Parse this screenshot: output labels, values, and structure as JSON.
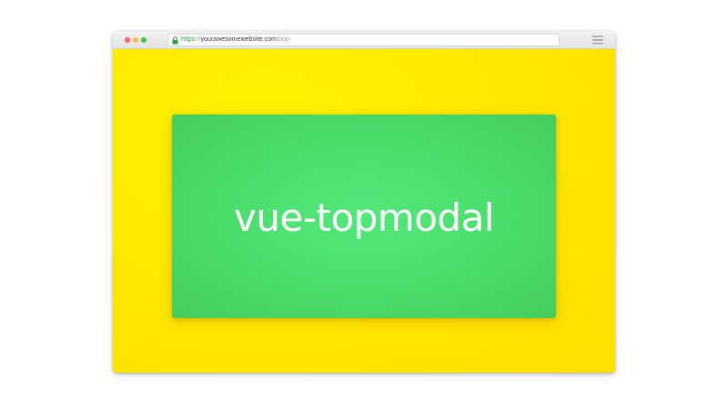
{
  "browser": {
    "url": {
      "scheme": "https",
      "separator": "://",
      "host": "yourawesomewebsite.com",
      "path": "/pop"
    },
    "icons": {
      "lock": "lock-icon",
      "menu": "hamburger-menu-icon"
    }
  },
  "page": {
    "modal": {
      "title": "vue-topmodal"
    }
  },
  "colors": {
    "page_background": "#ffe800",
    "modal_background": "#4cde6e",
    "url_scheme": "#2aa33c"
  }
}
